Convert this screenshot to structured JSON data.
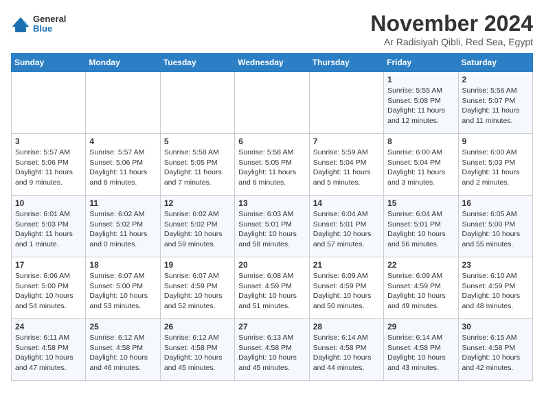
{
  "header": {
    "logo_line1": "General",
    "logo_line2": "Blue",
    "month_title": "November 2024",
    "subtitle": "Ar Radisiyah Qibli, Red Sea, Egypt"
  },
  "weekdays": [
    "Sunday",
    "Monday",
    "Tuesday",
    "Wednesday",
    "Thursday",
    "Friday",
    "Saturday"
  ],
  "weeks": [
    [
      {
        "day": "",
        "info": ""
      },
      {
        "day": "",
        "info": ""
      },
      {
        "day": "",
        "info": ""
      },
      {
        "day": "",
        "info": ""
      },
      {
        "day": "",
        "info": ""
      },
      {
        "day": "1",
        "info": "Sunrise: 5:55 AM\nSunset: 5:08 PM\nDaylight: 11 hours\nand 12 minutes."
      },
      {
        "day": "2",
        "info": "Sunrise: 5:56 AM\nSunset: 5:07 PM\nDaylight: 11 hours\nand 11 minutes."
      }
    ],
    [
      {
        "day": "3",
        "info": "Sunrise: 5:57 AM\nSunset: 5:06 PM\nDaylight: 11 hours\nand 9 minutes."
      },
      {
        "day": "4",
        "info": "Sunrise: 5:57 AM\nSunset: 5:06 PM\nDaylight: 11 hours\nand 8 minutes."
      },
      {
        "day": "5",
        "info": "Sunrise: 5:58 AM\nSunset: 5:05 PM\nDaylight: 11 hours\nand 7 minutes."
      },
      {
        "day": "6",
        "info": "Sunrise: 5:58 AM\nSunset: 5:05 PM\nDaylight: 11 hours\nand 6 minutes."
      },
      {
        "day": "7",
        "info": "Sunrise: 5:59 AM\nSunset: 5:04 PM\nDaylight: 11 hours\nand 5 minutes."
      },
      {
        "day": "8",
        "info": "Sunrise: 6:00 AM\nSunset: 5:04 PM\nDaylight: 11 hours\nand 3 minutes."
      },
      {
        "day": "9",
        "info": "Sunrise: 6:00 AM\nSunset: 5:03 PM\nDaylight: 11 hours\nand 2 minutes."
      }
    ],
    [
      {
        "day": "10",
        "info": "Sunrise: 6:01 AM\nSunset: 5:03 PM\nDaylight: 11 hours\nand 1 minute."
      },
      {
        "day": "11",
        "info": "Sunrise: 6:02 AM\nSunset: 5:02 PM\nDaylight: 11 hours\nand 0 minutes."
      },
      {
        "day": "12",
        "info": "Sunrise: 6:02 AM\nSunset: 5:02 PM\nDaylight: 10 hours\nand 59 minutes."
      },
      {
        "day": "13",
        "info": "Sunrise: 6:03 AM\nSunset: 5:01 PM\nDaylight: 10 hours\nand 58 minutes."
      },
      {
        "day": "14",
        "info": "Sunrise: 6:04 AM\nSunset: 5:01 PM\nDaylight: 10 hours\nand 57 minutes."
      },
      {
        "day": "15",
        "info": "Sunrise: 6:04 AM\nSunset: 5:01 PM\nDaylight: 10 hours\nand 56 minutes."
      },
      {
        "day": "16",
        "info": "Sunrise: 6:05 AM\nSunset: 5:00 PM\nDaylight: 10 hours\nand 55 minutes."
      }
    ],
    [
      {
        "day": "17",
        "info": "Sunrise: 6:06 AM\nSunset: 5:00 PM\nDaylight: 10 hours\nand 54 minutes."
      },
      {
        "day": "18",
        "info": "Sunrise: 6:07 AM\nSunset: 5:00 PM\nDaylight: 10 hours\nand 53 minutes."
      },
      {
        "day": "19",
        "info": "Sunrise: 6:07 AM\nSunset: 4:59 PM\nDaylight: 10 hours\nand 52 minutes."
      },
      {
        "day": "20",
        "info": "Sunrise: 6:08 AM\nSunset: 4:59 PM\nDaylight: 10 hours\nand 51 minutes."
      },
      {
        "day": "21",
        "info": "Sunrise: 6:09 AM\nSunset: 4:59 PM\nDaylight: 10 hours\nand 50 minutes."
      },
      {
        "day": "22",
        "info": "Sunrise: 6:09 AM\nSunset: 4:59 PM\nDaylight: 10 hours\nand 49 minutes."
      },
      {
        "day": "23",
        "info": "Sunrise: 6:10 AM\nSunset: 4:59 PM\nDaylight: 10 hours\nand 48 minutes."
      }
    ],
    [
      {
        "day": "24",
        "info": "Sunrise: 6:11 AM\nSunset: 4:58 PM\nDaylight: 10 hours\nand 47 minutes."
      },
      {
        "day": "25",
        "info": "Sunrise: 6:12 AM\nSunset: 4:58 PM\nDaylight: 10 hours\nand 46 minutes."
      },
      {
        "day": "26",
        "info": "Sunrise: 6:12 AM\nSunset: 4:58 PM\nDaylight: 10 hours\nand 45 minutes."
      },
      {
        "day": "27",
        "info": "Sunrise: 6:13 AM\nSunset: 4:58 PM\nDaylight: 10 hours\nand 45 minutes."
      },
      {
        "day": "28",
        "info": "Sunrise: 6:14 AM\nSunset: 4:58 PM\nDaylight: 10 hours\nand 44 minutes."
      },
      {
        "day": "29",
        "info": "Sunrise: 6:14 AM\nSunset: 4:58 PM\nDaylight: 10 hours\nand 43 minutes."
      },
      {
        "day": "30",
        "info": "Sunrise: 6:15 AM\nSunset: 4:58 PM\nDaylight: 10 hours\nand 42 minutes."
      }
    ]
  ]
}
